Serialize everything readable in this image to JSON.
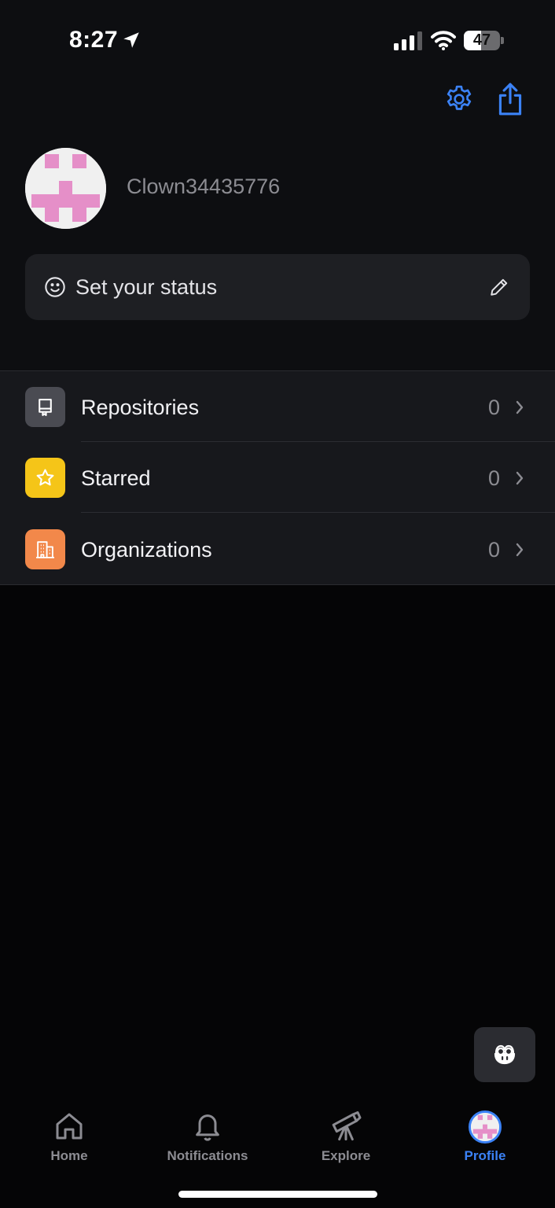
{
  "status_bar": {
    "time": "8:27",
    "battery_level": "47",
    "battery_fraction": 0.47,
    "icons": [
      "location-arrow-icon",
      "cellular-signal-icon",
      "wifi-icon",
      "battery-icon"
    ]
  },
  "header": {
    "settings_icon": "gear-icon",
    "share_icon": "share-icon",
    "accent_color": "#3b82f6"
  },
  "profile": {
    "username": "Clown34435776",
    "avatar_colors": {
      "background": "#f0f0f0",
      "pixel": "#e58fc8"
    }
  },
  "status": {
    "label": "Set your status",
    "icon": "smile-icon",
    "edit_icon": "pencil-icon"
  },
  "menu": {
    "items": [
      {
        "label": "Repositories",
        "count": "0",
        "icon": "repo-icon",
        "icon_bg": "#4a4b52"
      },
      {
        "label": "Starred",
        "count": "0",
        "icon": "star-icon",
        "icon_bg": "#f5c518"
      },
      {
        "label": "Organizations",
        "count": "0",
        "icon": "organization-icon",
        "icon_bg": "#f2884a"
      }
    ]
  },
  "copilot": {
    "icon": "copilot-icon"
  },
  "tabbar": {
    "tabs": [
      {
        "label": "Home",
        "icon": "home-icon",
        "active": false
      },
      {
        "label": "Notifications",
        "icon": "bell-icon",
        "active": false
      },
      {
        "label": "Explore",
        "icon": "telescope-icon",
        "active": false
      },
      {
        "label": "Profile",
        "icon": "avatar-icon",
        "active": true
      }
    ]
  }
}
